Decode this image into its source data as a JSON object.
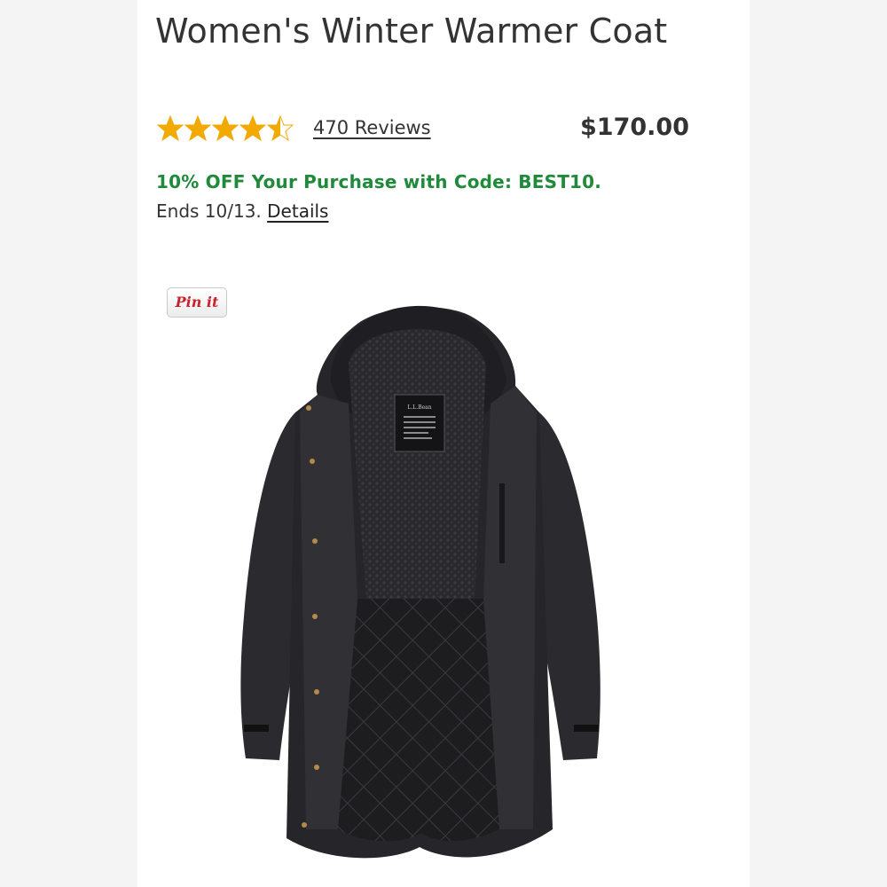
{
  "product": {
    "title": "Women's Winter Warmer Coat",
    "rating": 4.5,
    "rating_max": 5,
    "reviews_label": "470 Reviews",
    "price": "$170.00",
    "star_color": "#f2a900"
  },
  "promo": {
    "headline": "10% OFF Your Purchase with Code: BEST10.",
    "ends_text": "Ends 10/13.",
    "details_label": "Details",
    "color": "#1e8a3a"
  },
  "pin_button": {
    "label": "Pin it"
  },
  "product_image": {
    "label": "L.L.Bean"
  },
  "icons": {
    "stars": "star-icon",
    "pin": "pinterest-icon"
  }
}
